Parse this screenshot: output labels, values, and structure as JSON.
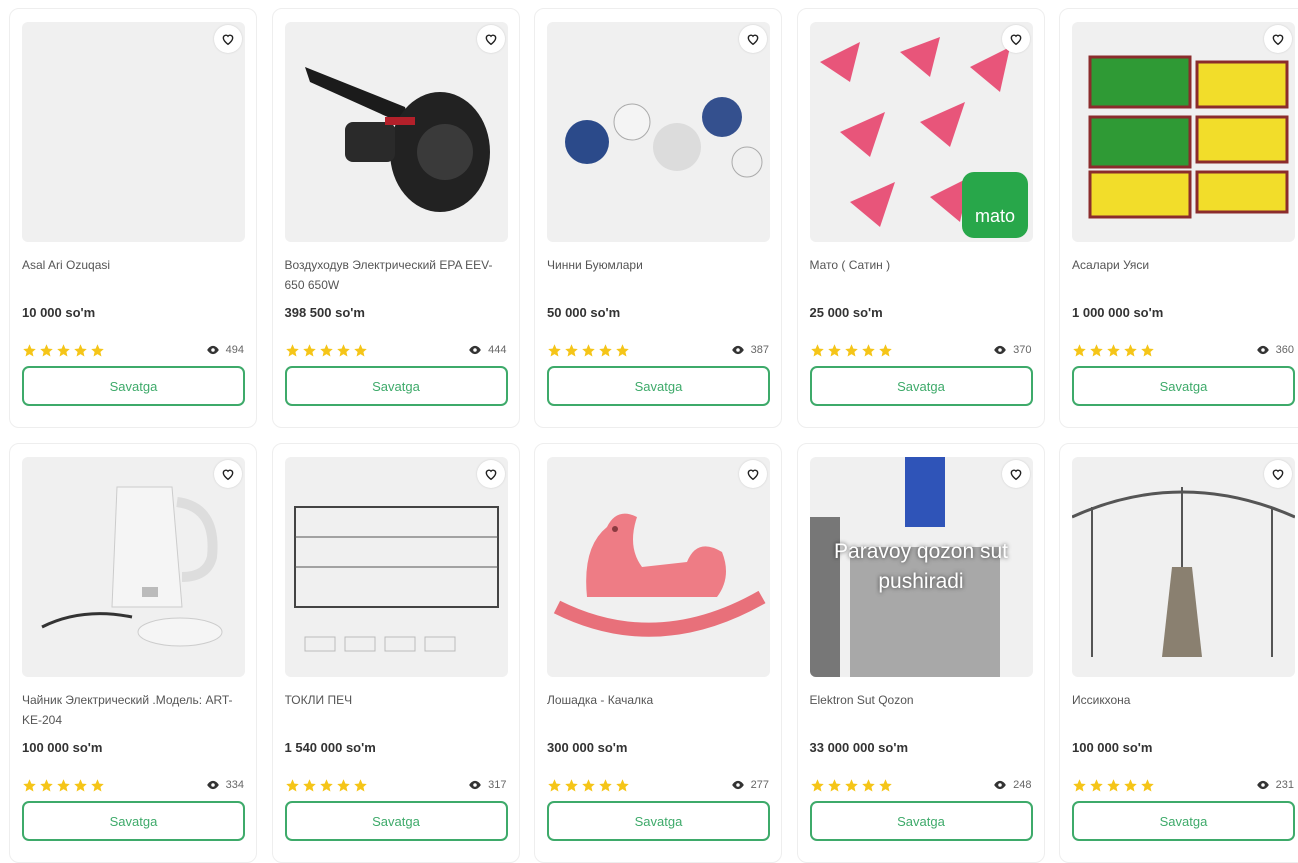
{
  "products": [
    {
      "name": "Asal Ari Ozuqasi",
      "price": "10 000 so'm",
      "views": "494",
      "rating": 5,
      "button": "Savatga"
    },
    {
      "name": "Воздуходув Электрический EPA EEV-650 650W",
      "price": "398 500 so'm",
      "views": "444",
      "rating": 5,
      "button": "Savatga"
    },
    {
      "name": "Чинни Буюмлари",
      "price": "50 000 so'm",
      "views": "387",
      "rating": 5,
      "button": "Savatga"
    },
    {
      "name": "Мато ( Сатин )",
      "price": "25 000 so'm",
      "views": "370",
      "rating": 5,
      "button": "Savatga"
    },
    {
      "name": "Асалари Уяси",
      "price": "1 000 000 so'm",
      "views": "360",
      "rating": 5,
      "button": "Savatga"
    },
    {
      "name": "Чайник Электрический .Модель: ART-KE-204",
      "price": "100 000 so'm",
      "views": "334",
      "rating": 5,
      "button": "Savatga"
    },
    {
      "name": "ТОКЛИ ПЕЧ",
      "price": "1 540 000 so'm",
      "views": "317",
      "rating": 5,
      "button": "Savatga"
    },
    {
      "name": "Лошадка - Качалка",
      "price": "300 000 so'm",
      "views": "277",
      "rating": 5,
      "button": "Savatga"
    },
    {
      "name": "Elektron Sut Qozon",
      "price": "33 000 000 so'm",
      "views": "248",
      "rating": 5,
      "button": "Savatga",
      "image_text": "Paravoy qozon sut pushiradi"
    },
    {
      "name": "Иссикхона",
      "price": "100 000 so'm",
      "views": "231",
      "rating": 5,
      "button": "Savatga"
    }
  ],
  "fabric_logo": "mato",
  "colors": {
    "accent": "#3eaa6a",
    "star": "#f5c518"
  }
}
